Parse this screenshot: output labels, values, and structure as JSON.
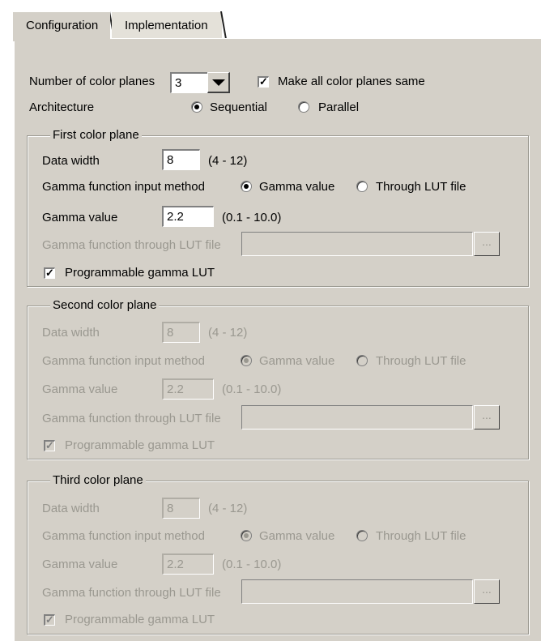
{
  "tabs": {
    "configuration": "Configuration",
    "implementation": "Implementation"
  },
  "top": {
    "num_planes_label": "Number of color planes",
    "num_planes_value": "3",
    "same_label": "Make all color planes same",
    "same_checked": true,
    "arch_label": "Architecture",
    "arch_sequential": "Sequential",
    "arch_parallel": "Parallel",
    "arch_selected": "Sequential"
  },
  "planes": [
    {
      "title": "First color plane",
      "enabled": true,
      "data_width_label": "Data width",
      "data_width_value": "8",
      "data_width_range": "(4 - 12)",
      "method_label": "Gamma function input method",
      "method_gamma": "Gamma value",
      "method_lut": "Through LUT file",
      "gamma_label": "Gamma value",
      "gamma_value": "2.2",
      "gamma_range": "(0.1 - 10.0)",
      "lut_label": "Gamma function through LUT file",
      "lut_value": "",
      "browse_label": "...",
      "programmable_label": "Programmable gamma LUT",
      "programmable_checked": true
    },
    {
      "title": "Second color plane",
      "enabled": false,
      "data_width_label": "Data width",
      "data_width_value": "8",
      "data_width_range": "(4 - 12)",
      "method_label": "Gamma function input method",
      "method_gamma": "Gamma value",
      "method_lut": "Through LUT file",
      "gamma_label": "Gamma value",
      "gamma_value": "2.2",
      "gamma_range": "(0.1 - 10.0)",
      "lut_label": "Gamma function through LUT file",
      "lut_value": "",
      "browse_label": "...",
      "programmable_label": "Programmable gamma LUT",
      "programmable_checked": true
    },
    {
      "title": "Third color plane",
      "enabled": false,
      "data_width_label": "Data width",
      "data_width_value": "8",
      "data_width_range": "(4 - 12)",
      "method_label": "Gamma function input method",
      "method_gamma": "Gamma value",
      "method_lut": "Through LUT file",
      "gamma_label": "Gamma value",
      "gamma_value": "2.2",
      "gamma_range": "(0.1 - 10.0)",
      "lut_label": "Gamma function through LUT file",
      "lut_value": "",
      "browse_label": "...",
      "programmable_label": "Programmable gamma LUT",
      "programmable_checked": true
    }
  ],
  "colors": {
    "panel": "#d4d0c8",
    "disabled_text": "#9a9890"
  }
}
